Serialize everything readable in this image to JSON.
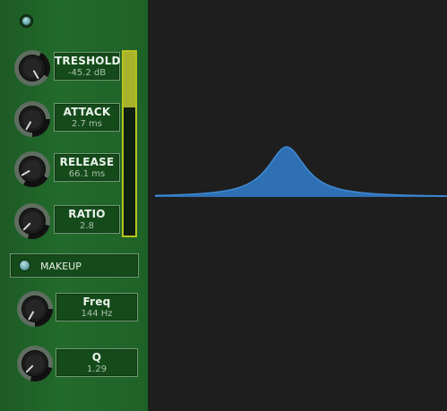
{
  "panel": {
    "params": [
      {
        "id": "threshold",
        "label": "TRESHOLD",
        "value": "-45.2 dB"
      },
      {
        "id": "attack",
        "label": "ATTACK",
        "value": "2.7 ms"
      },
      {
        "id": "release",
        "label": "RELEASE",
        "value": "66.1 ms"
      },
      {
        "id": "ratio",
        "label": "RATIO",
        "value": "2.8"
      }
    ],
    "makeup": {
      "label": "MAKEUP"
    },
    "filter": [
      {
        "id": "freq",
        "label": "Freq",
        "value": "144 Hz"
      },
      {
        "id": "q",
        "label": "Q",
        "value": "1.29"
      }
    ],
    "meter": {
      "level": 0.3
    }
  },
  "colors": {
    "panel_green": "#226a2b",
    "meter_yellow": "#b8c21e",
    "curve_fill": "#2f6fb3",
    "curve_stroke": "#3f8bd6",
    "graph_bg": "#1e1e1e"
  }
}
